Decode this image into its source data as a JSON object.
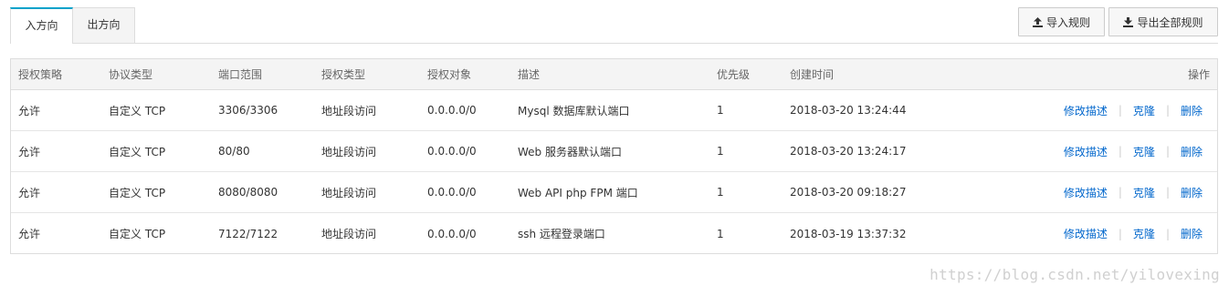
{
  "tabs": [
    {
      "label": "入方向",
      "active": true
    },
    {
      "label": "出方向",
      "active": false
    }
  ],
  "toolbar": {
    "import_label": "导入规则",
    "export_label": "导出全部规则",
    "import_icon": "upload-icon",
    "export_icon": "download-icon"
  },
  "table": {
    "headers": {
      "policy": "授权策略",
      "protocol": "协议类型",
      "port_range": "端口范围",
      "auth_type": "授权类型",
      "auth_target": "授权对象",
      "description": "描述",
      "priority": "优先级",
      "created_at": "创建时间",
      "actions": "操作"
    },
    "rows": [
      {
        "policy": "允许",
        "protocol": "自定义 TCP",
        "port_range": "3306/3306",
        "auth_type": "地址段访问",
        "auth_target": "0.0.0.0/0",
        "description": "Mysql 数据库默认端口",
        "priority": "1",
        "created_at": "2018-03-20 13:24:44"
      },
      {
        "policy": "允许",
        "protocol": "自定义 TCP",
        "port_range": "80/80",
        "auth_type": "地址段访问",
        "auth_target": "0.0.0.0/0",
        "description": "Web 服务器默认端口",
        "priority": "1",
        "created_at": "2018-03-20 13:24:17"
      },
      {
        "policy": "允许",
        "protocol": "自定义 TCP",
        "port_range": "8080/8080",
        "auth_type": "地址段访问",
        "auth_target": "0.0.0.0/0",
        "description": "Web API php FPM 端口",
        "priority": "1",
        "created_at": "2018-03-20 09:18:27"
      },
      {
        "policy": "允许",
        "protocol": "自定义 TCP",
        "port_range": "7122/7122",
        "auth_type": "地址段访问",
        "auth_target": "0.0.0.0/0",
        "description": "ssh 远程登录端口",
        "priority": "1",
        "created_at": "2018-03-19 13:37:32"
      }
    ],
    "actions": {
      "edit_desc": "修改描述",
      "clone": "克隆",
      "delete": "删除",
      "separator": "|"
    }
  },
  "watermark": "https://blog.csdn.net/yilovexing",
  "colors": {
    "accent": "#00a2ca",
    "link": "#0066cc",
    "header_bg": "#f4f4f4",
    "border": "#dddddd"
  }
}
